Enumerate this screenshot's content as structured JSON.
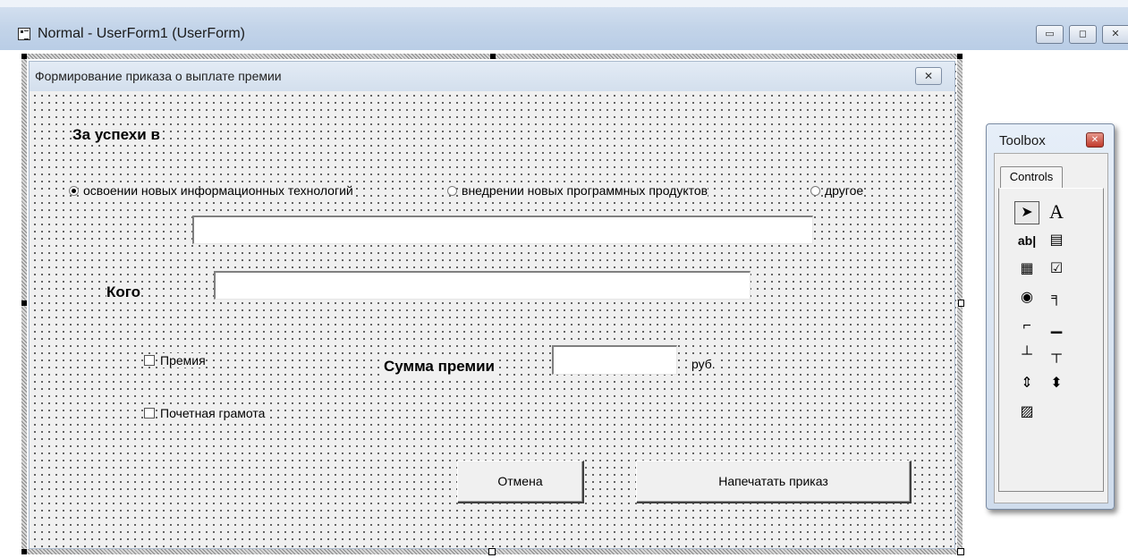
{
  "designer": {
    "title": "Normal - UserForm1 (UserForm)",
    "min_glyph": "▭",
    "max_glyph": "◻",
    "close_glyph": "✕"
  },
  "form": {
    "title": "Формирование приказа о выплате премии",
    "close_glyph": "✕",
    "success_label": "За успехи в",
    "options": [
      {
        "label": "освоении новых информационных технологий",
        "selected": true
      },
      {
        "label": "внедрении новых программных продуктов",
        "selected": false
      },
      {
        "label": "другое",
        "selected": false
      }
    ],
    "other_text": {
      "value": ""
    },
    "who_label": "Кого",
    "who_text": {
      "value": ""
    },
    "checkbox_bonus": "Премия",
    "checkbox_diploma": "Почетная грамота",
    "amount_label": "Сумма премии",
    "amount_text": {
      "value": ""
    },
    "currency_label": "руб.",
    "cancel_button": "Отмена",
    "print_button": "Напечатать приказ"
  },
  "toolbox": {
    "title": "Toolbox",
    "close_glyph": "✕",
    "tab_label": "Controls",
    "tools": [
      {
        "name": "select-objects",
        "glyph": "➤"
      },
      {
        "name": "label",
        "glyph": "A"
      },
      {
        "name": "textbox",
        "glyph": "ab|"
      },
      {
        "name": "combobox",
        "glyph": "▤"
      },
      {
        "name": "listbox",
        "glyph": "▦"
      },
      {
        "name": "checkbox",
        "glyph": "☑"
      },
      {
        "name": "option-button",
        "glyph": "◉"
      },
      {
        "name": "toggle-button",
        "glyph": "╕"
      },
      {
        "name": "frame",
        "glyph": "⌐"
      },
      {
        "name": "command-button",
        "glyph": "▁"
      },
      {
        "name": "tabstrip",
        "glyph": "┴"
      },
      {
        "name": "multipage",
        "glyph": "┬"
      },
      {
        "name": "scrollbar",
        "glyph": "⇕"
      },
      {
        "name": "spinbutton",
        "glyph": "⬍"
      },
      {
        "name": "image",
        "glyph": "▨"
      }
    ]
  }
}
